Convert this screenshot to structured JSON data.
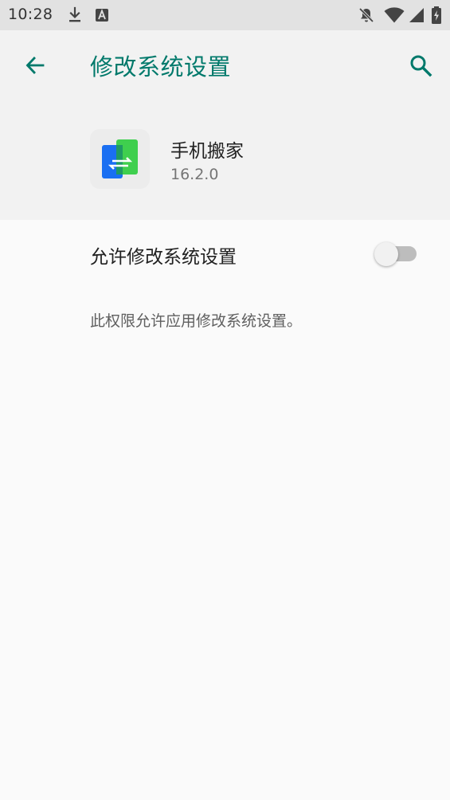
{
  "status_bar": {
    "time": "10:28",
    "left_icons": [
      "download-icon",
      "a-notification-icon"
    ],
    "right_icons": [
      "notifications-off-icon",
      "wifi-icon",
      "cell-signal-icon",
      "battery-charging-icon"
    ]
  },
  "toolbar": {
    "title": "修改系统设置",
    "back_icon": "arrow-back-icon",
    "search_icon": "search-icon",
    "accent_color": "#00796b"
  },
  "app": {
    "name": "手机搬家",
    "version": "16.2.0",
    "icon": "phone-clone-icon"
  },
  "setting": {
    "label": "允许修改系统设置",
    "enabled": false
  },
  "description": "此权限允许应用修改系统设置。"
}
